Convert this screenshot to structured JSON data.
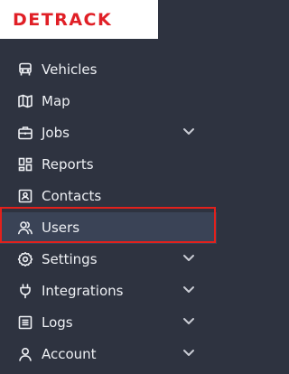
{
  "brand": {
    "logo_text": "DETRACK",
    "accent_color": "#e01f26"
  },
  "theme": {
    "sidebar_bg": "#2e3340",
    "active_bg": "#3a4356",
    "highlight_border": "#e2211c"
  },
  "nav": {
    "items": [
      {
        "label": "Vehicles",
        "icon": "truck-icon",
        "expandable": false
      },
      {
        "label": "Map",
        "icon": "map-icon",
        "expandable": false
      },
      {
        "label": "Jobs",
        "icon": "briefcase-icon",
        "expandable": true
      },
      {
        "label": "Reports",
        "icon": "dashboard-icon",
        "expandable": false
      },
      {
        "label": "Contacts",
        "icon": "contact-card-icon",
        "expandable": false
      },
      {
        "label": "Users",
        "icon": "users-icon",
        "expandable": false,
        "active": true
      },
      {
        "label": "Settings",
        "icon": "gear-icon",
        "expandable": true
      },
      {
        "label": "Integrations",
        "icon": "plug-icon",
        "expandable": true
      },
      {
        "label": "Logs",
        "icon": "list-icon",
        "expandable": true
      },
      {
        "label": "Account",
        "icon": "user-icon",
        "expandable": true
      }
    ]
  }
}
